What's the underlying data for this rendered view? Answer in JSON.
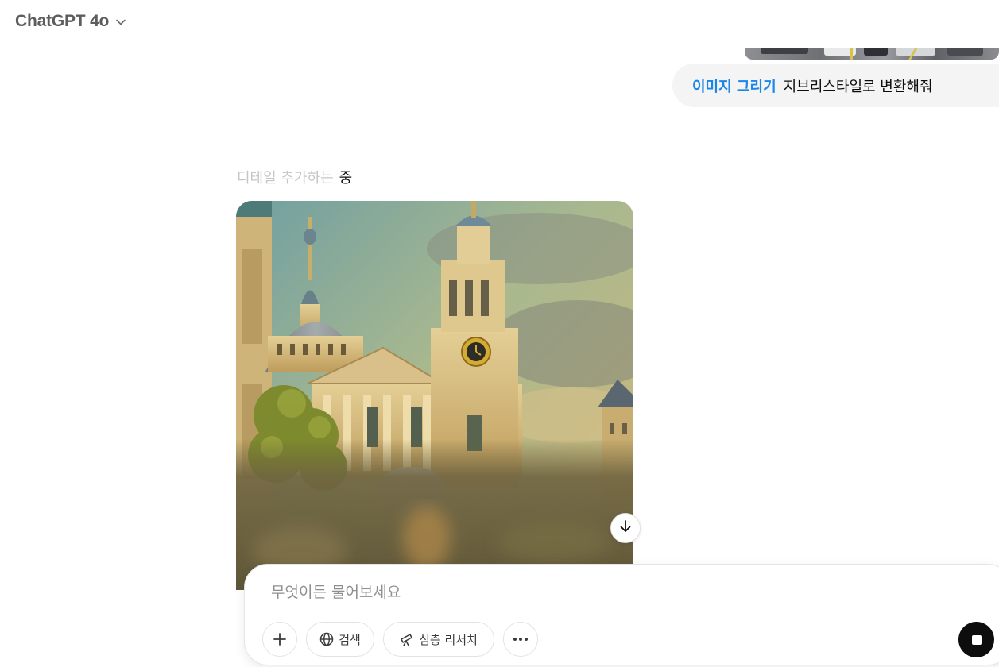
{
  "header": {
    "model_name": "ChatGPT 4o",
    "icons": {
      "dropdown": "chevron-down-icon"
    }
  },
  "conversation": {
    "previous_attachment": "photo",
    "user_message": {
      "tool_tag": "이미지 그리기",
      "text": "지브리스타일로 변환해줘"
    },
    "assistant": {
      "status_faint": "디테일 추가하는",
      "status_strong": "중",
      "generated_image": "painted cathedral"
    },
    "scroll_down_icon": "arrow-down-icon"
  },
  "composer": {
    "placeholder": "무엇이든 물어보세요",
    "value": "",
    "buttons": {
      "add_icon": "plus-icon",
      "search_label": "검색",
      "search_icon": "globe-icon",
      "research_label": "심층 리서치",
      "research_icon": "telescope-icon",
      "more_icon": "more-horizontal-icon",
      "stop_icon": "stop-icon"
    }
  },
  "colors": {
    "tool_tag": "#1a86e8",
    "user_bubble": "#f4f4f4",
    "status_faint": "#c6c6c6",
    "stop_button": "#0d0d0d"
  }
}
